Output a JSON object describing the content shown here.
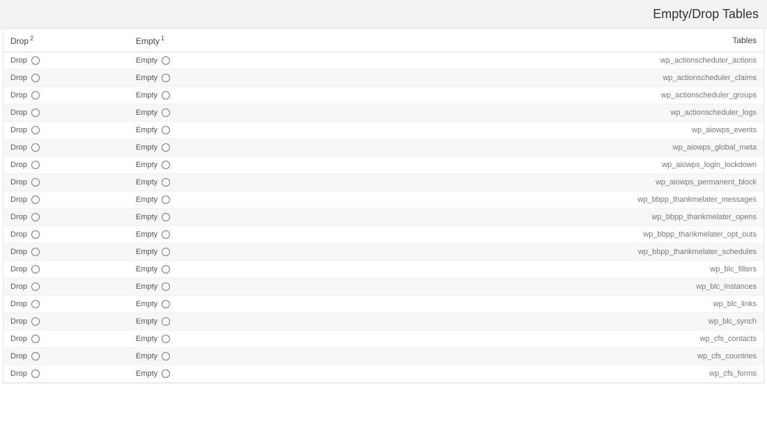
{
  "header": {
    "title": "Empty/Drop Tables"
  },
  "columns": {
    "drop": {
      "label": "Drop",
      "footnote": "2"
    },
    "empty": {
      "label": "Empty",
      "footnote": "1"
    },
    "tables": {
      "label": "Tables"
    }
  },
  "row_labels": {
    "drop": "Drop",
    "empty": "Empty"
  },
  "tables": [
    "wp_actionscheduler_actions",
    "wp_actionscheduler_claims",
    "wp_actionscheduler_groups",
    "wp_actionscheduler_logs",
    "wp_aiowps_events",
    "wp_aiowps_global_meta",
    "wp_aiowps_login_lockdown",
    "wp_aiowps_permanent_block",
    "wp_bbpp_thankmelater_messages",
    "wp_bbpp_thankmelater_opens",
    "wp_bbpp_thankmelater_opt_outs",
    "wp_bbpp_thankmelater_schedules",
    "wp_blc_filters",
    "wp_blc_instances",
    "wp_blc_links",
    "wp_blc_synch",
    "wp_cfs_contacts",
    "wp_cfs_countries",
    "wp_cfs_forms"
  ]
}
